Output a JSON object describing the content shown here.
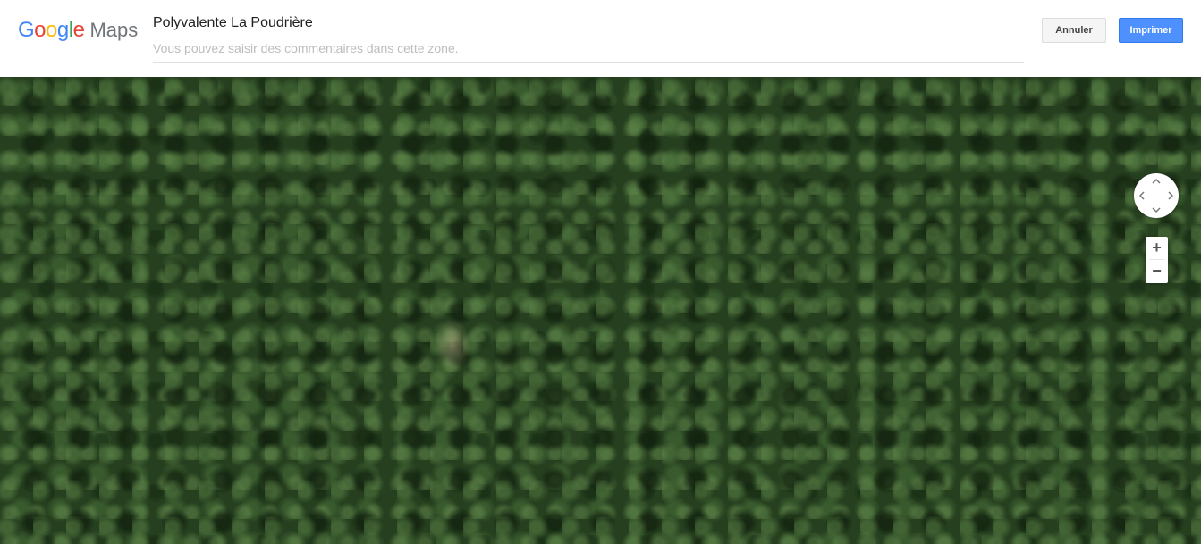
{
  "header": {
    "logo": {
      "letters": [
        {
          "char": "G",
          "color": "#4285F4"
        },
        {
          "char": "o",
          "color": "#EA4335"
        },
        {
          "char": "o",
          "color": "#FBBC05"
        },
        {
          "char": "g",
          "color": "#4285F4"
        },
        {
          "char": "l",
          "color": "#34A853"
        },
        {
          "char": "e",
          "color": "#EA4335"
        }
      ],
      "product": "Maps"
    },
    "place_title": "Polyvalente La Poudrière",
    "comment_placeholder": "Vous pouvez saisir des commentaires dans cette zone.",
    "comment_value": "",
    "cancel_label": "Annuler",
    "print_label": "Imprimer"
  },
  "map": {
    "view": "satellite",
    "controls": {
      "pan_icons": [
        "chevron-up-icon",
        "chevron-down-icon",
        "chevron-left-icon",
        "chevron-right-icon"
      ],
      "zoom_in_label": "+",
      "zoom_out_label": "−"
    }
  },
  "colors": {
    "primary_button": "#4d90fe",
    "secondary_button": "#f5f5f5",
    "forest": "#26401f"
  }
}
